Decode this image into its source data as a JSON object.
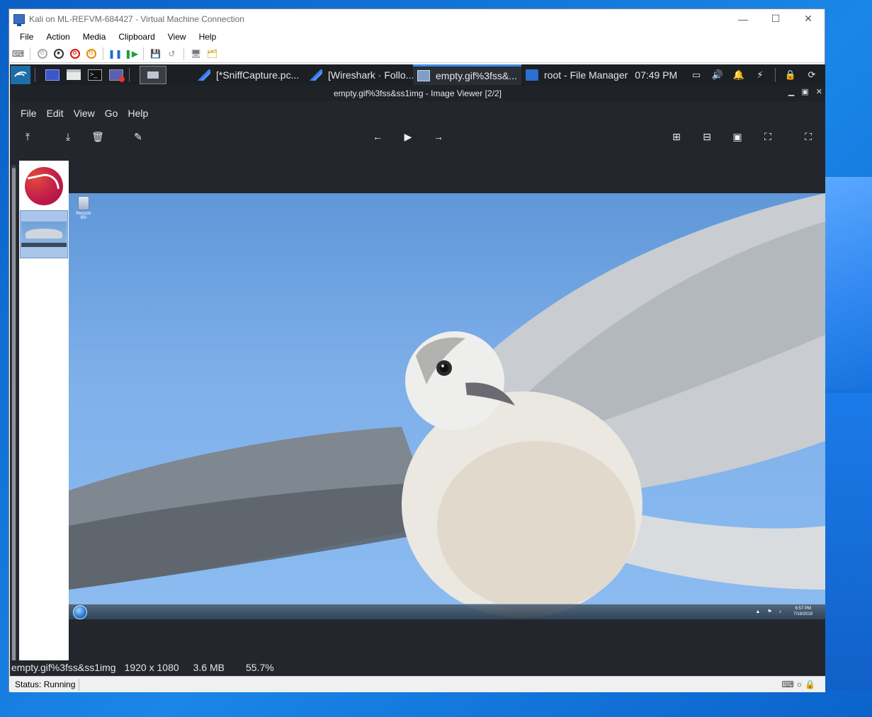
{
  "vm": {
    "title": "Kali on ML-REFVM-684427 - Virtual Machine Connection",
    "menu": [
      "File",
      "Action",
      "Media",
      "Clipboard",
      "View",
      "Help"
    ],
    "status": "Status: Running"
  },
  "panel": {
    "tasks": [
      {
        "label": "[*SniffCapture.pc...",
        "active": false
      },
      {
        "label": "[Wireshark · Follo...",
        "active": false
      },
      {
        "label": "empty.gif%3fss&...",
        "active": true
      },
      {
        "label": "root - File Manager",
        "active": false
      }
    ],
    "clock": "07:49 PM"
  },
  "viewer": {
    "title": "empty.gif%3fss&ss1img - Image Viewer [2/2]",
    "menu": [
      "File",
      "Edit",
      "View",
      "Go",
      "Help"
    ],
    "status": {
      "filename": "empty.gif%3fss&ss1img",
      "dimensions": "1920 x 1080",
      "size": "3.6 MB",
      "zoom": "55.7%"
    }
  },
  "image": {
    "desktop_icon_label": "Recycle Bin",
    "win_clock_time": "6:57 PM",
    "win_clock_date": "7/19/2019"
  },
  "colors": {
    "panel_bg": "#1c1f24",
    "viewer_bg": "#23262d",
    "active_task_accent": "#3b8de6",
    "sky": "#7fb0ea"
  }
}
